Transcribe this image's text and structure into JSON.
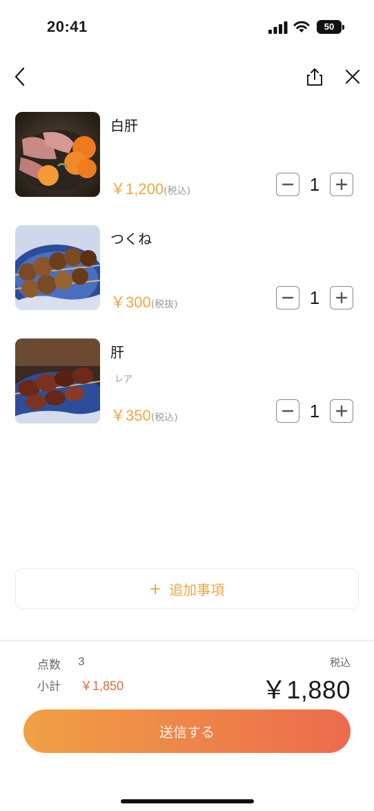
{
  "status_bar": {
    "time": "20:41",
    "battery": "50"
  },
  "items": [
    {
      "name": "白肝",
      "note": "",
      "price": "￥1,200",
      "tax": "(税込)",
      "qty": "1"
    },
    {
      "name": "つくね",
      "note": "",
      "price": "￥300",
      "tax": "(税抜)",
      "qty": "1"
    },
    {
      "name": "肝",
      "note": "レア",
      "price": "￥350",
      "tax": "(税込)",
      "qty": "1"
    }
  ],
  "add_extra": {
    "label": "追加事項"
  },
  "summary": {
    "count_label": "点数",
    "count": "3",
    "subtotal_label": "小計",
    "subtotal": "￥1,850",
    "tax_label": "税込",
    "total": "￥1,880"
  },
  "submit": {
    "label": "送信する"
  },
  "colors": {
    "accent": "#f0a640",
    "subtotal": "#e06a3a",
    "button_start": "#f0a145",
    "button_end": "#ec6b4d"
  },
  "icons": [
    "back-icon",
    "share-icon",
    "close-icon",
    "minus-icon",
    "plus-icon",
    "signal-icon",
    "wifi-icon",
    "battery-icon"
  ]
}
